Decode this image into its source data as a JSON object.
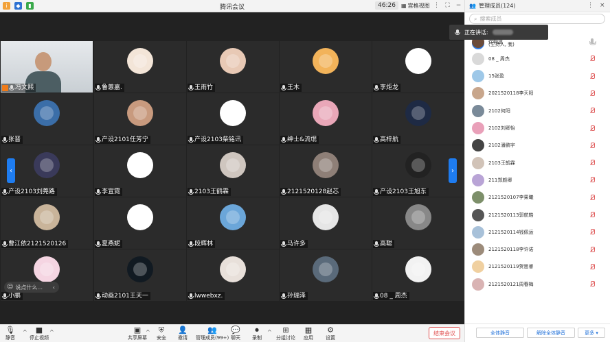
{
  "window": {
    "title": "腾讯会议",
    "timer": "46:26",
    "view_label": "宫格视图"
  },
  "speaking": {
    "label": "正在讲话:"
  },
  "tiles": [
    {
      "name": "冯文熙",
      "host": true,
      "avatar": "camera-person",
      "bg": "#d8dde0"
    },
    {
      "name": "鲁蕙嘉.",
      "avatar": "cartoon-pig",
      "bg": "#f3e5d8"
    },
    {
      "name": "王雨竹",
      "avatar": "girl-photo",
      "bg": "#e8c9b5"
    },
    {
      "name": "王木",
      "avatar": "orange-cat",
      "bg": "#f2b35a"
    },
    {
      "name": "李炬龙",
      "avatar": "line-drawing",
      "bg": "#ffffff"
    },
    {
      "name": "张晋",
      "avatar": "deer-cartoon",
      "bg": "#3b6ea8"
    },
    {
      "name": "产设2101任芳宁",
      "avatar": "girl-selfie",
      "bg": "#c89a7e"
    },
    {
      "name": "产设2103柴铭讯",
      "avatar": "red-mask",
      "bg": "#ffffff"
    },
    {
      "name": "绅士&流氓",
      "avatar": "anime-boy",
      "bg": "#e9a7b8"
    },
    {
      "name": "高梓航",
      "avatar": "night-sky",
      "bg": "#1e2a44"
    },
    {
      "name": "产设2103刘莞路",
      "avatar": "lotus",
      "bg": "#3a3a5a"
    },
    {
      "name": "李宣霓",
      "avatar": "panda-dog",
      "bg": "#ffffff"
    },
    {
      "name": "2103王鹤霖",
      "avatar": "woman-portrait",
      "bg": "#cfc6bf"
    },
    {
      "name": "2121520128赵芯",
      "avatar": "girl-hat",
      "bg": "#8e7f77"
    },
    {
      "name": "产设2103王旭东",
      "avatar": "peaky-man",
      "bg": "#222222"
    },
    {
      "name": "曹江依2121520126",
      "avatar": "anime-girl",
      "bg": "#c9b49a"
    },
    {
      "name": "夏燕妮",
      "avatar": "dog-face",
      "bg": "#ffffff"
    },
    {
      "name": "段辉林",
      "avatar": "yellow-cartoon",
      "bg": "#6ba6d9"
    },
    {
      "name": "马许多",
      "avatar": "red-cartoon",
      "bg": "#e6e6e6"
    },
    {
      "name": "高聪",
      "avatar": "bw-portrait",
      "bg": "#888888"
    },
    {
      "name": "小鹏",
      "avatar": "pink-cartoon",
      "bg": "#f5d5e2"
    },
    {
      "name": "动画2101王天一",
      "avatar": "dark-art",
      "bg": "#111a22"
    },
    {
      "name": "lwwebxz.",
      "avatar": "woman-white",
      "bg": "#e8e0da"
    },
    {
      "name": "孙瑞泽",
      "avatar": "man-photo",
      "bg": "#5a6a7a"
    },
    {
      "name": "08 _ 周杰",
      "avatar": "sketch-man",
      "bg": "#f2f2f2"
    }
  ],
  "chat": {
    "placeholder": "说点什么..."
  },
  "toolbar": {
    "mute": "静音",
    "stop_video": "停止视频",
    "share": "共享屏幕",
    "security": "安全",
    "invite": "邀请",
    "members": "管理成员(99+)",
    "chat": "聊天",
    "record": "录制",
    "breakout": "分组讨论",
    "apps": "应用",
    "settings": "设置",
    "end": "结束会议"
  },
  "panel": {
    "title": "管理成员(124)",
    "search_placeholder": "搜索成员",
    "host_suffix": "(主持人, 我)",
    "members": [
      {
        "name": "徐翰道",
        "mic": "on",
        "bg": "#6b4b3a"
      },
      {
        "name": "08 _ 周杰",
        "mic": "muted",
        "bg": "#d9d9d9"
      },
      {
        "name": "15张盈",
        "mic": "muted",
        "bg": "#9ec8e8"
      },
      {
        "name": "2021520118李天阳",
        "mic": "muted",
        "bg": "#c8a68c"
      },
      {
        "name": "2102何阳",
        "mic": "muted",
        "bg": "#7a8a99"
      },
      {
        "name": "2102刘卿怡",
        "mic": "muted",
        "bg": "#e9a0b9"
      },
      {
        "name": "2102潘鹏宇",
        "mic": "muted",
        "bg": "#444444"
      },
      {
        "name": "2103王鹤霖",
        "mic": "muted",
        "bg": "#d1c3b8"
      },
      {
        "name": "211郑颜卿",
        "mic": "muted",
        "bg": "#b9a4d6"
      },
      {
        "name": "2121520107李果曦",
        "mic": "muted",
        "bg": "#7d8f6a"
      },
      {
        "name": "2121520113郭航皓",
        "mic": "muted",
        "bg": "#555555"
      },
      {
        "name": "2121520114钱佩运",
        "mic": "muted",
        "bg": "#a8c1d9"
      },
      {
        "name": "2121520118李许诺",
        "mic": "muted",
        "bg": "#9c8b7a"
      },
      {
        "name": "2121520119贺思睿",
        "mic": "muted",
        "bg": "#f0d0a0"
      },
      {
        "name": "2121520121周春梅",
        "mic": "muted",
        "bg": "#d9b3b3"
      }
    ],
    "mute_all": "全体静音",
    "unmute_all": "解除全体静音",
    "more": "更多"
  }
}
